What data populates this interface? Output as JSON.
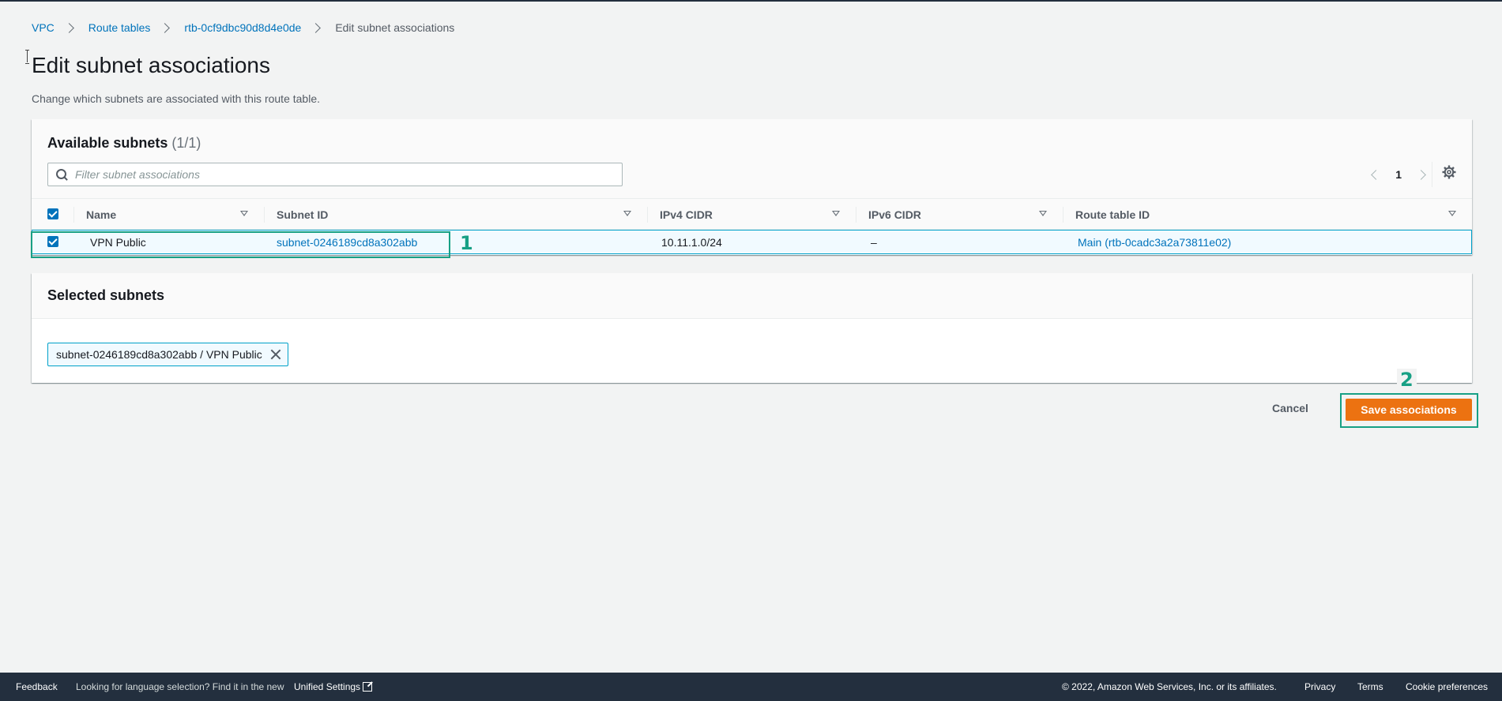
{
  "breadcrumb": {
    "items": [
      "VPC",
      "Route tables",
      "rtb-0cf9dbc90d8d4e0de"
    ],
    "current": "Edit subnet associations"
  },
  "page": {
    "title": "Edit subnet associations",
    "description": "Change which subnets are associated with this route table."
  },
  "available": {
    "title": "Available subnets",
    "count": "(1/1)",
    "filter_placeholder": "Filter subnet associations",
    "page": "1",
    "columns": [
      "Name",
      "Subnet ID",
      "IPv4 CIDR",
      "IPv6 CIDR",
      "Route table ID"
    ],
    "rows": [
      {
        "name": "VPN Public",
        "subnet_id": "subnet-0246189cd8a302abb",
        "ipv4": "10.11.1.0/24",
        "ipv6": "–",
        "route_table": "Main (rtb-0cadc3a2a73811e02)"
      }
    ]
  },
  "selected": {
    "title": "Selected subnets",
    "token": "subnet-0246189cd8a302abb / VPN Public"
  },
  "actions": {
    "cancel": "Cancel",
    "save": "Save associations"
  },
  "annotations": [
    "1",
    "2"
  ],
  "footer": {
    "feedback": "Feedback",
    "language_text": "Looking for language selection? Find it in the new",
    "unified_settings": "Unified Settings",
    "copyright": "© 2022, Amazon Web Services, Inc. or its affiliates.",
    "privacy": "Privacy",
    "terms": "Terms",
    "cookies": "Cookie preferences"
  },
  "colors": {
    "accent": "#0073bb",
    "primary_button": "#ec7211",
    "annotation": "#17a085",
    "footer_bg": "#232f3e"
  }
}
